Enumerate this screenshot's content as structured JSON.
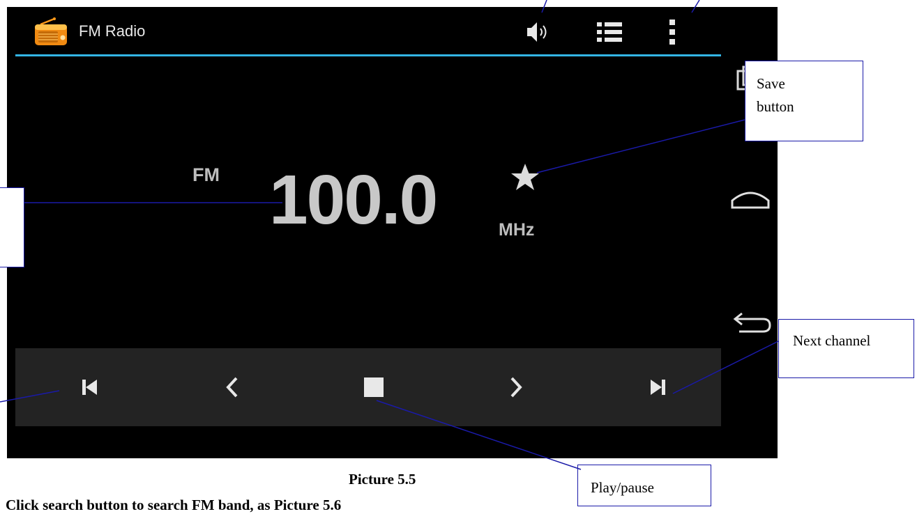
{
  "app": {
    "title": "FM Radio",
    "icon": "radio-icon"
  },
  "action_bar": {
    "icons": [
      "speaker-icon",
      "channel-list-icon",
      "overflow-menu-icon"
    ],
    "divider_color": "#33b5e5"
  },
  "tuner": {
    "band": "FM",
    "frequency": "100.0",
    "unit": "MHz",
    "favorite_icon": "star-icon"
  },
  "navigation_bar": {
    "icons": [
      "recent-apps-icon",
      "home-icon",
      "back-icon"
    ]
  },
  "controls": {
    "icons": [
      "previous-channel-icon",
      "seek-back-icon",
      "stop-icon",
      "seek-forward-icon",
      "next-channel-icon"
    ]
  },
  "callouts": {
    "save": "Save button",
    "next": "Next channel",
    "play": "Play/pause"
  },
  "caption": "Picture 5.5",
  "instruction": "Click search button to search FM band, as Picture 5.6",
  "colors": {
    "screen_bg": "#000000",
    "control_bar_bg": "#232323",
    "accent": "#33b5e5",
    "callout_border": "#1a1aa8"
  }
}
